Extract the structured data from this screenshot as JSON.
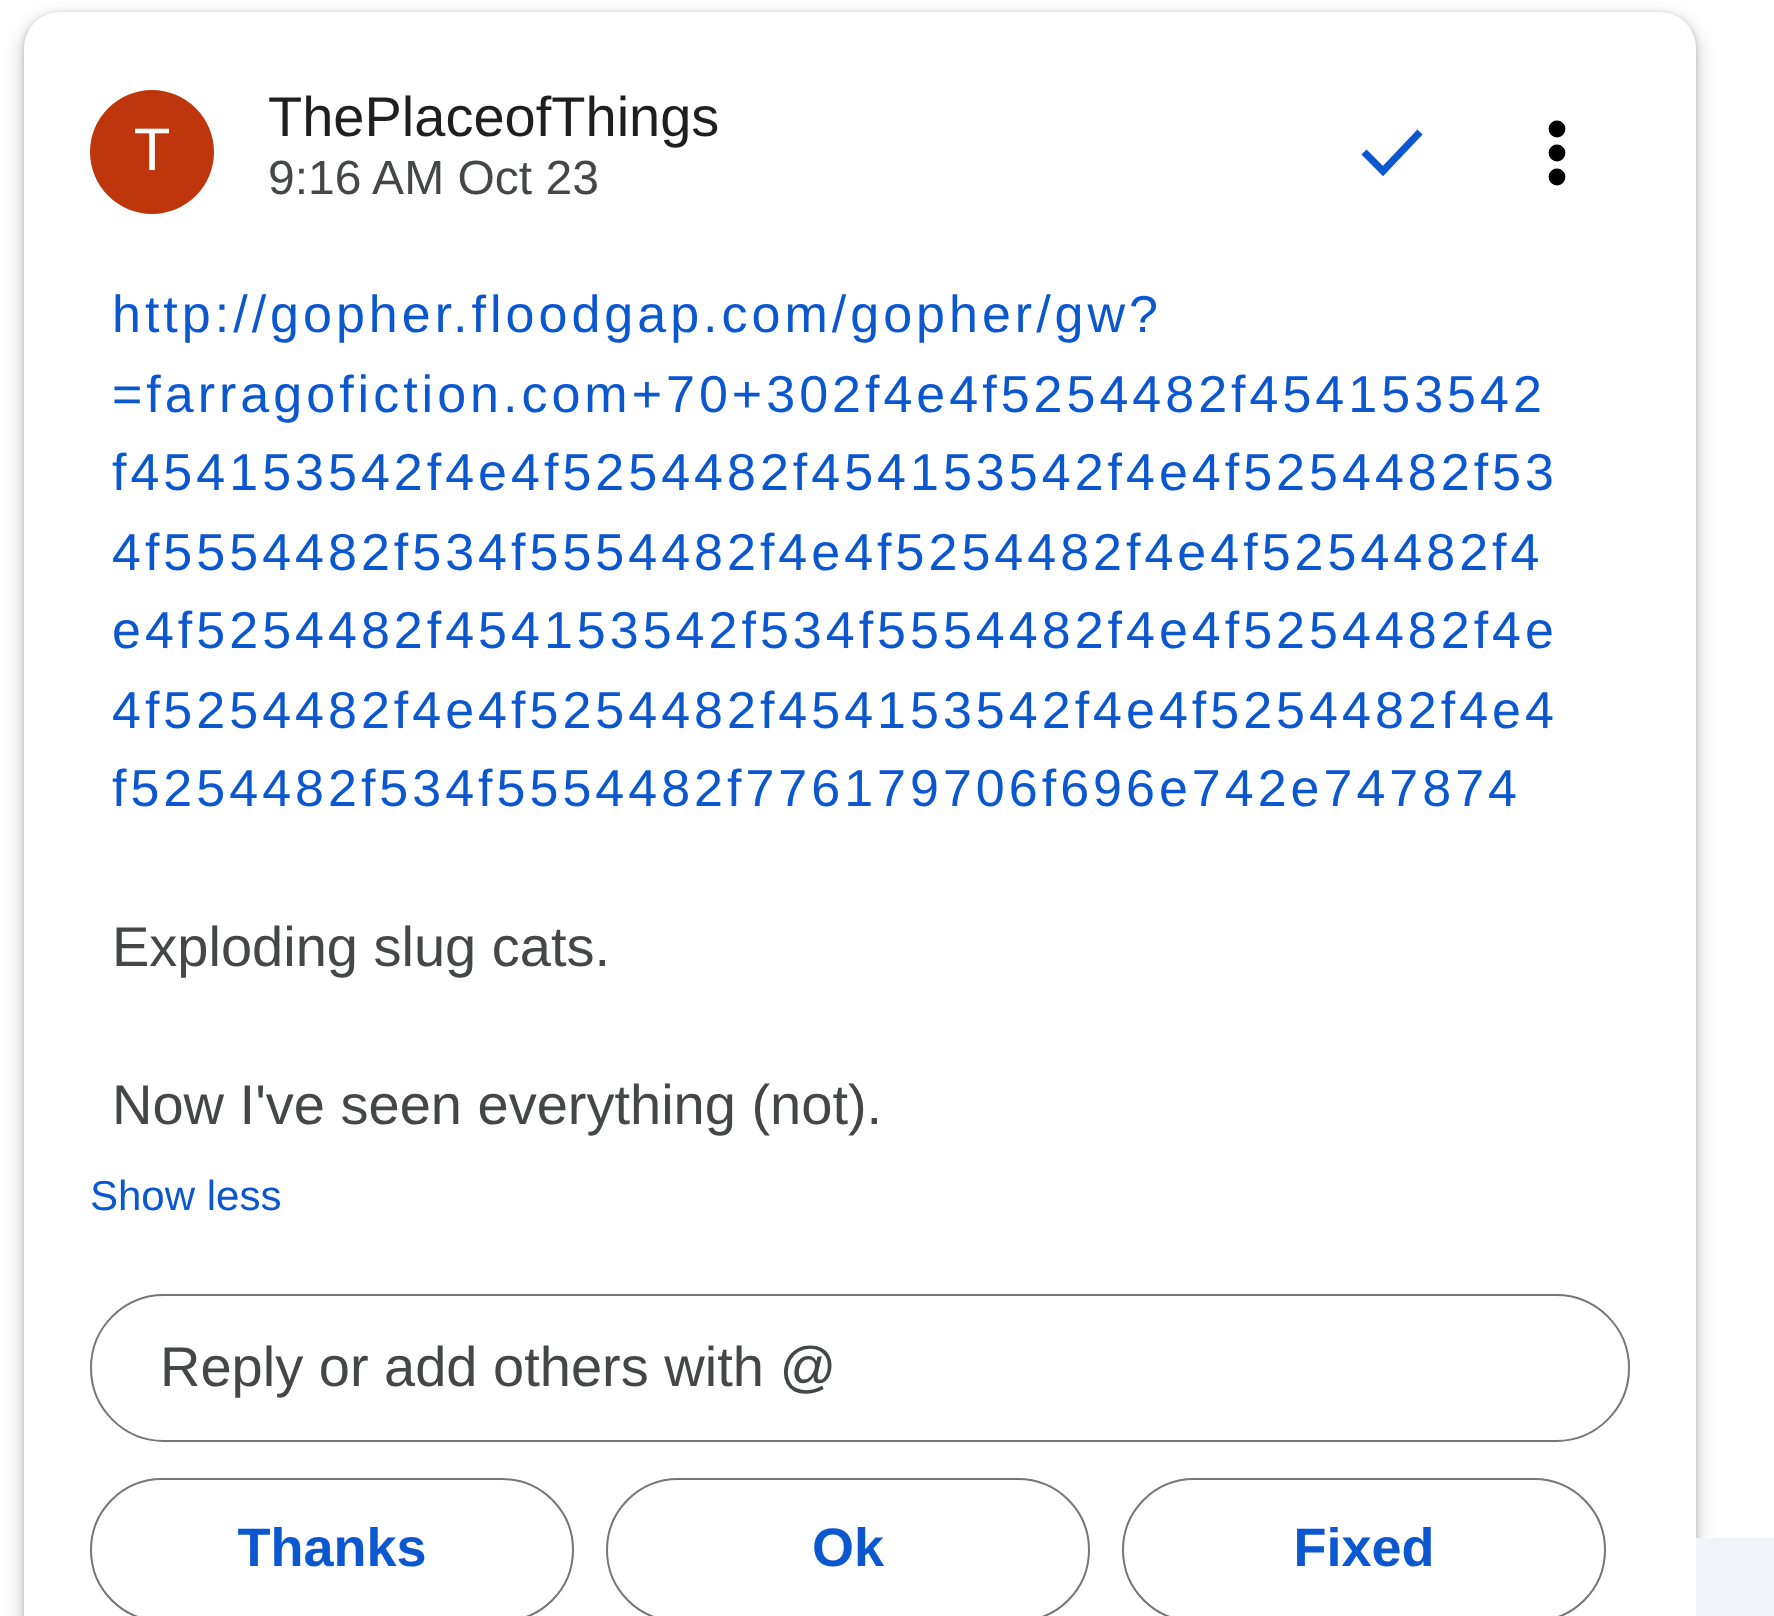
{
  "comment": {
    "author": {
      "initial": "T",
      "name": "ThePlaceofThings"
    },
    "time": "9:16 AM Oct 23"
  },
  "body": [
    {
      "kind": "link",
      "text": "http://gopher.floodgap.com/gopher/gw?=farragofiction.com+70+302f4e4f5254482f454153542f454153542f4e4f5254482f454153542f4e4f5254482f534f5554482f534f5554482f4e4f5254482f4e4f5254482f4e4f5254482f454153542f534f5554482f4e4f5254482f4e4f5254482f4e4f5254482f454153542f4e4f5254482f4e4f5254482f534f5554482f776179706f696e742e747874"
    },
    {
      "kind": "paragraph",
      "text": "Exploding slug cats."
    },
    {
      "kind": "paragraph",
      "text": "Now I've seen everything (not)."
    }
  ],
  "toggle_link": "Show less",
  "reply": {
    "placeholder": "Reply or add others with @"
  },
  "quick_replies": [
    "Thanks",
    "Ok",
    "Fixed"
  ]
}
